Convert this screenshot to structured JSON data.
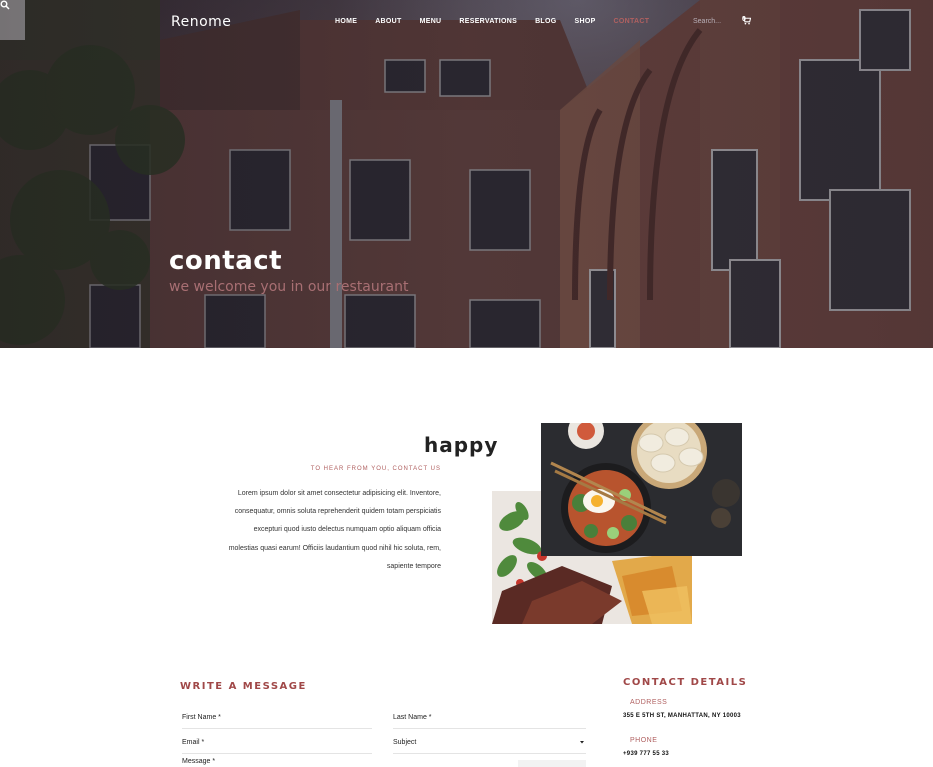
{
  "header": {
    "brand": "Renome",
    "nav": [
      {
        "label": "HOME",
        "active": false
      },
      {
        "label": "ABOUT",
        "active": false
      },
      {
        "label": "MENU",
        "active": false
      },
      {
        "label": "RESERVATIONS",
        "active": false
      },
      {
        "label": "BLOG",
        "active": false
      },
      {
        "label": "SHOP",
        "active": false
      },
      {
        "label": "CONTACT",
        "active": true
      }
    ],
    "search_placeholder": "Search...",
    "cart_count": "0",
    "icons": {
      "search": "search-icon",
      "cart": "cart-icon"
    }
  },
  "hero": {
    "title": "contact",
    "subtitle": "we welcome you in our restaurant"
  },
  "intro": {
    "title": "happy",
    "kicker": "TO HEAR FROM YOU, CONTACT US",
    "lines": [
      "Lorem ipsum dolor sit amet consectetur adipisicing elit. Inventore,",
      "consequatur, omnis soluta reprehenderit quidem totam perspiciatis",
      "excepturi quod iusto delectus numquam optio aliquam officia",
      "molestias quasi earum! Officiis laudantium quod nihil hic soluta, rem,",
      "sapiente tempore"
    ]
  },
  "form": {
    "title": "WRITE A MESSAGE",
    "first_name": "First Name *",
    "last_name": "Last Name *",
    "email": "Email *",
    "subject": "Subject",
    "message": "Message *"
  },
  "details": {
    "title": "CONTACT DETAILS",
    "address_label": "ADDRESS",
    "address": "355 E 5TH ST, MANHATTAN, NY 10003",
    "phone_label": "PHONE",
    "phone": "+939 777 55 33"
  },
  "colors": {
    "accent": "#b06060",
    "hero_dark": "#3b3037"
  }
}
